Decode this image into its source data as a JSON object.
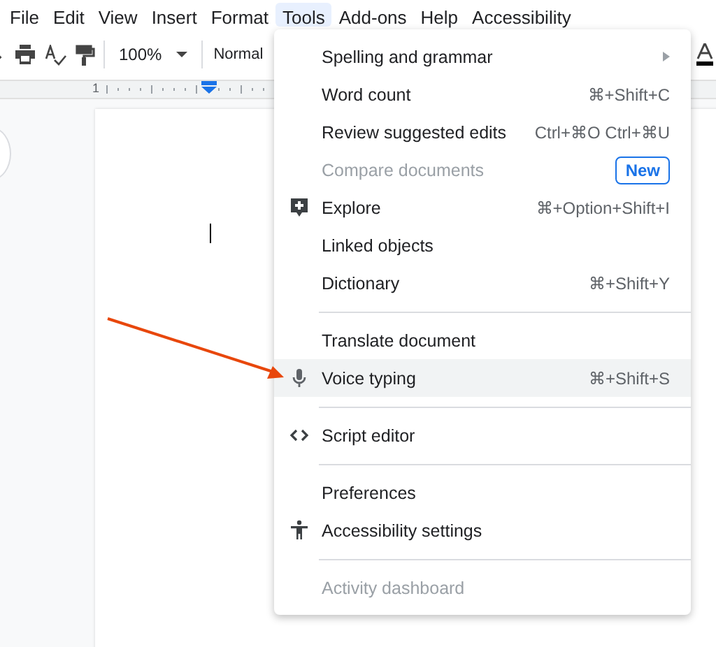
{
  "menubar": [
    {
      "label": "File",
      "selected": false
    },
    {
      "label": "Edit",
      "selected": false
    },
    {
      "label": "View",
      "selected": false
    },
    {
      "label": "Insert",
      "selected": false
    },
    {
      "label": "Format",
      "selected": false
    },
    {
      "label": "Tools",
      "selected": true
    },
    {
      "label": "Add-ons",
      "selected": false
    },
    {
      "label": "Help",
      "selected": false
    },
    {
      "label": "Accessibility",
      "selected": false
    }
  ],
  "toolbar": {
    "zoom": "100%",
    "style": "Normal"
  },
  "ruler": {
    "number": "1"
  },
  "menu": [
    {
      "kind": "item",
      "label": "Spelling and grammar",
      "submenu": true,
      "disabled": false,
      "selected": false
    },
    {
      "kind": "item",
      "label": "Word count",
      "shortcut": "⌘+Shift+C",
      "disabled": false,
      "selected": false
    },
    {
      "kind": "item",
      "label": "Review suggested edits",
      "shortcut": "Ctrl+⌘O Ctrl+⌘U",
      "disabled": false,
      "selected": false
    },
    {
      "kind": "item",
      "label": "Compare documents",
      "badge": "New",
      "disabled": true,
      "selected": false
    },
    {
      "kind": "explore",
      "label": "Explore",
      "shortcut": "⌘+Option+Shift+I",
      "disabled": false,
      "selected": false
    },
    {
      "kind": "item",
      "label": "Linked objects",
      "disabled": false,
      "selected": false
    },
    {
      "kind": "item",
      "label": "Dictionary",
      "shortcut": "⌘+Shift+Y",
      "disabled": false,
      "selected": false
    },
    {
      "kind": "separator"
    },
    {
      "kind": "item",
      "label": "Translate document",
      "disabled": false,
      "selected": false
    },
    {
      "kind": "voice",
      "label": "Voice typing",
      "shortcut": "⌘+Shift+S",
      "disabled": false,
      "selected": true
    },
    {
      "kind": "separator"
    },
    {
      "kind": "script",
      "label": "Script editor",
      "disabled": false,
      "selected": false
    },
    {
      "kind": "separator"
    },
    {
      "kind": "item",
      "label": "Preferences",
      "disabled": false,
      "selected": false
    },
    {
      "kind": "accessibility",
      "label": "Accessibility settings",
      "disabled": false,
      "selected": false
    },
    {
      "kind": "separator"
    },
    {
      "kind": "item",
      "label": "Activity dashboard",
      "disabled": true,
      "selected": false
    }
  ]
}
